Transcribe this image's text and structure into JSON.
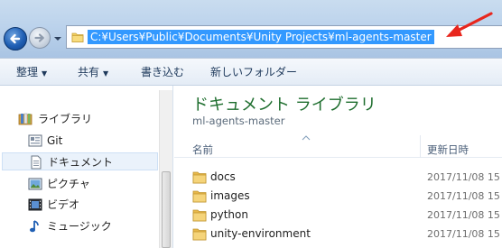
{
  "address": {
    "path": "C:¥Users¥Public¥Documents¥Unity Projects¥ml-agents-master"
  },
  "toolbar": {
    "organize": "整理",
    "share": "共有",
    "burn": "書き込む",
    "new_folder": "新しいフォルダー"
  },
  "nav": {
    "items": [
      {
        "label": "ライブラリ",
        "icon": "library-icon"
      },
      {
        "label": "Git",
        "icon": "git-library-icon"
      },
      {
        "label": "ドキュメント",
        "icon": "documents-icon"
      },
      {
        "label": "ピクチャ",
        "icon": "pictures-icon"
      },
      {
        "label": "ビデオ",
        "icon": "videos-icon"
      },
      {
        "label": "ミュージック",
        "icon": "music-icon"
      }
    ]
  },
  "content": {
    "title": "ドキュメント ライブラリ",
    "subtitle": "ml-agents-master",
    "columns": {
      "name": "名前",
      "date": "更新日時"
    },
    "files": [
      {
        "name": "docs",
        "date": "2017/11/08 15"
      },
      {
        "name": "images",
        "date": "2017/11/08 15"
      },
      {
        "name": "python",
        "date": "2017/11/08 15"
      },
      {
        "name": "unity-environment",
        "date": "2017/11/08 15"
      }
    ]
  },
  "colors": {
    "selection": "#3399ff",
    "title_green": "#1e6e2e",
    "annotation_arrow": "#e8261d"
  }
}
